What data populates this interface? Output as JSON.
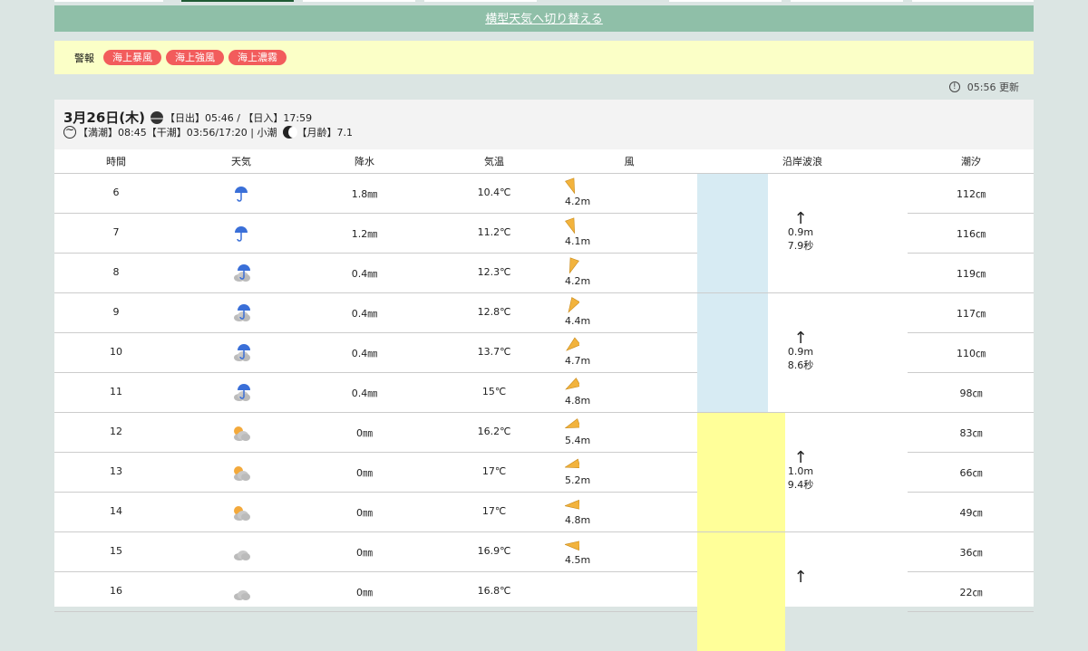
{
  "switch_link": "横型天気へ切り替える",
  "warnings": {
    "label": "警報",
    "badges": [
      "海上暴風",
      "海上強風",
      "海上濃霧"
    ]
  },
  "updated": "05:56 更新",
  "day": {
    "date": "3月26日(木)",
    "sun": "【日出】05:46 / 【日入】17:59",
    "tide": "【満潮】08:45【干潮】03:56/17:20 | 小潮",
    "moon": "【月齢】7.1"
  },
  "headers": {
    "time": "時間",
    "weather": "天気",
    "precip": "降水",
    "temp": "気温",
    "wind": "風",
    "wave": "沿岸波浪",
    "tide": "潮汐"
  },
  "rows": [
    {
      "hour": "6",
      "weather": "rain-icon",
      "precip": "1.8㎜",
      "temp": "10.4℃",
      "wind": "4.2m",
      "tide": "112㎝"
    },
    {
      "hour": "7",
      "weather": "rain-icon",
      "precip": "1.2㎜",
      "temp": "11.2℃",
      "wind": "4.1m",
      "tide": "116㎝"
    },
    {
      "hour": "8",
      "weather": "cloud-rain-icon",
      "precip": "0.4㎜",
      "temp": "12.3℃",
      "wind": "4.2m",
      "tide": "119㎝"
    },
    {
      "hour": "9",
      "weather": "cloud-rain-icon",
      "precip": "0.4㎜",
      "temp": "12.8℃",
      "wind": "4.4m",
      "tide": "117㎝"
    },
    {
      "hour": "10",
      "weather": "cloud-rain-icon",
      "precip": "0.4㎜",
      "temp": "13.7℃",
      "wind": "4.7m",
      "tide": "110㎝"
    },
    {
      "hour": "11",
      "weather": "cloud-rain-icon",
      "precip": "0.4㎜",
      "temp": "15℃",
      "wind": "4.8m",
      "tide": "98㎝"
    },
    {
      "hour": "12",
      "weather": "sun-cloud-icon",
      "precip": "0㎜",
      "temp": "16.2℃",
      "wind": "5.4m",
      "tide": "83㎝"
    },
    {
      "hour": "13",
      "weather": "sun-cloud-icon",
      "precip": "0㎜",
      "temp": "17℃",
      "wind": "5.2m",
      "tide": "66㎝"
    },
    {
      "hour": "14",
      "weather": "sun-cloud-icon",
      "precip": "0㎜",
      "temp": "17℃",
      "wind": "4.8m",
      "tide": "49㎝"
    },
    {
      "hour": "15",
      "weather": "cloud-icon",
      "precip": "0㎜",
      "temp": "16.9℃",
      "wind": "4.5m",
      "tide": "36㎝"
    },
    {
      "hour": "16",
      "weather": "cloud-icon",
      "precip": "0㎜",
      "temp": "16.8℃",
      "wind": "",
      "tide": "22㎝"
    }
  ],
  "waves": [
    {
      "height": "0.9m",
      "period": "7.9秒",
      "color": "#d7ebf3"
    },
    {
      "height": "0.9m",
      "period": "8.6秒",
      "color": "#d7ebf3"
    },
    {
      "height": "1.0m",
      "period": "9.4秒",
      "color": "#ffff99"
    },
    {
      "height": "",
      "period": "",
      "color": "#ffff99"
    }
  ]
}
